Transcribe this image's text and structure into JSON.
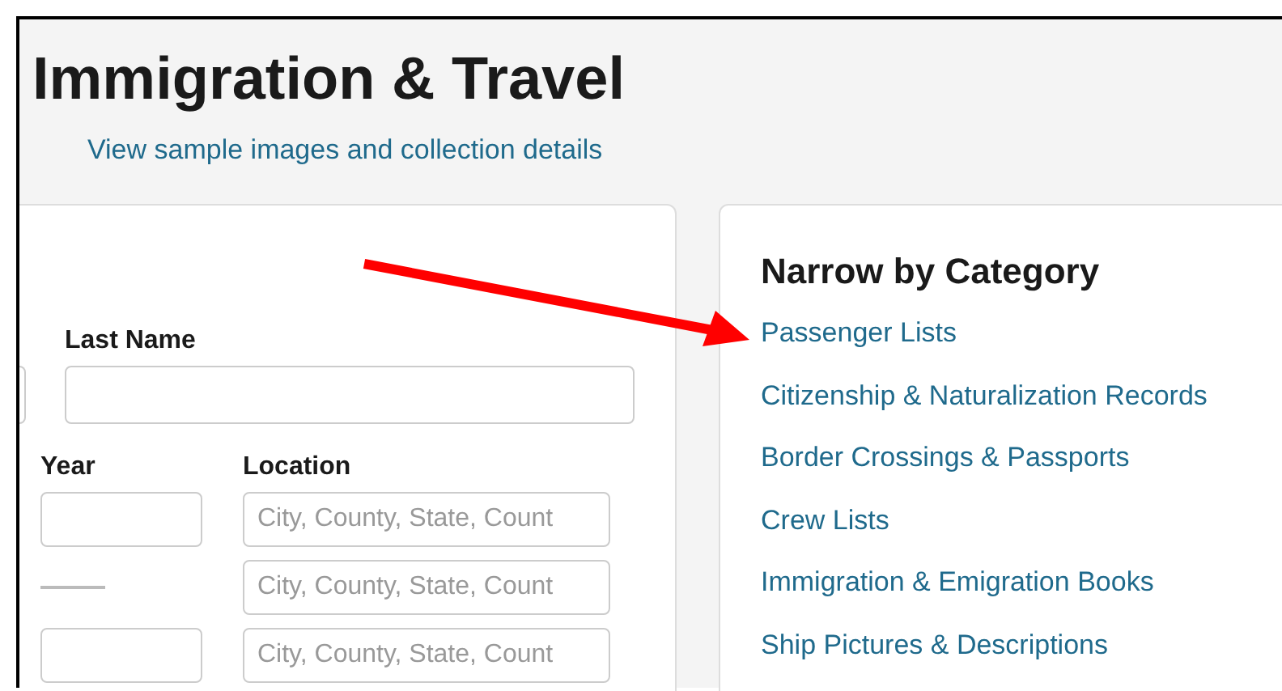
{
  "page": {
    "title": "Immigration & Travel",
    "link": "View sample images and collection details"
  },
  "search_form": {
    "last_name": {
      "label": "Last Name"
    },
    "year": {
      "label": "Year"
    },
    "location": {
      "label": "Location"
    },
    "rows": [
      {
        "kind": "field",
        "location_placeholder": "City, County, State, Count"
      },
      {
        "kind": "dash",
        "location_placeholder": "City, County, State, Count"
      },
      {
        "kind": "field",
        "location_placeholder": "City, County, State, Count"
      }
    ]
  },
  "narrow_by_category": {
    "heading": "Narrow by Category",
    "items": [
      "Passenger Lists",
      "Citizenship & Naturalization Records",
      "Border Crossings & Passports",
      "Crew Lists",
      "Immigration & Emigration Books",
      "Ship Pictures & Descriptions"
    ]
  }
}
